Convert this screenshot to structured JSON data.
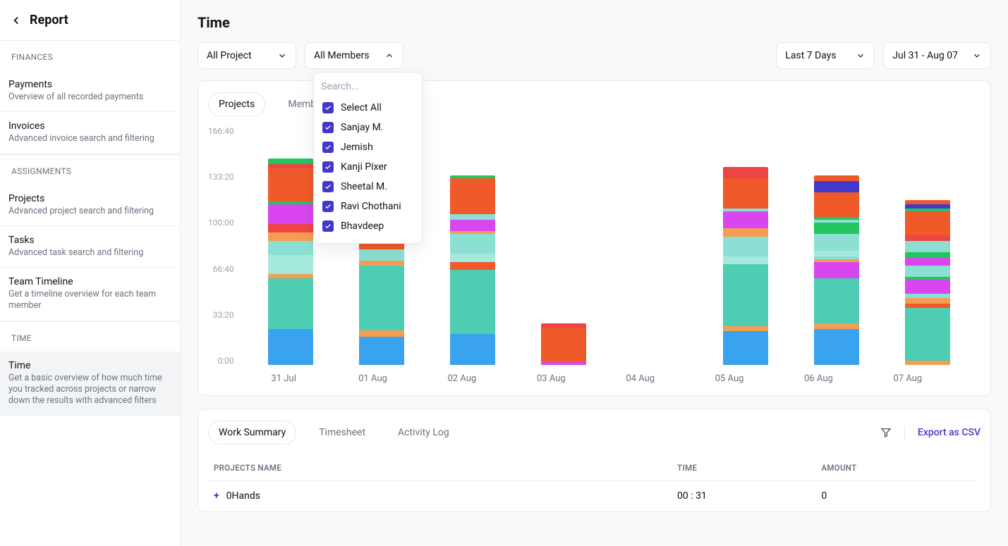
{
  "sidebar": {
    "back_label": "Report",
    "sections": [
      {
        "label": "FINANCES",
        "items": [
          {
            "title": "Payments",
            "sub": "Overview of all recorded payments"
          },
          {
            "title": "Invoices",
            "sub": "Advanced invoice search and filtering"
          }
        ]
      },
      {
        "label": "ASSIGNMENTS",
        "items": [
          {
            "title": "Projects",
            "sub": "Advanced project search and filtering"
          },
          {
            "title": "Tasks",
            "sub": "Advanced task search and filtering"
          },
          {
            "title": "Team Timeline",
            "sub": "Get a timeline overview for each team member"
          }
        ]
      },
      {
        "label": "TIME",
        "items": [
          {
            "title": "Time",
            "sub": "Get a basic overview of how much time you tracked across projects or narrow down the results with advanced filters",
            "active": true
          }
        ]
      }
    ]
  },
  "page_title": "Time",
  "filters": {
    "project": "All Project",
    "members": "All Members",
    "range_preset": "Last 7 Days",
    "range_dates": "Jul 31 - Aug 07"
  },
  "members_dropdown": {
    "search_placeholder": "Search...",
    "options": [
      "Select All",
      "Sanjay M.",
      "Jemish",
      "Kanji Pixer",
      "Sheetal M.",
      "Ravi Chothani",
      "Bhavdeep"
    ]
  },
  "chart_tabs": [
    "Projects",
    "Members"
  ],
  "chart_active_tab": "Projects",
  "chart_data": {
    "type": "bar",
    "stacked": true,
    "ylabel": "",
    "xlabel": "",
    "ylim": [
      0,
      166.67
    ],
    "y_ticks": [
      "166:40",
      "133:20",
      "100:00",
      "66:40",
      "33:20",
      "0:00"
    ],
    "categories": [
      "31 Jul",
      "01 Aug",
      "02 Aug",
      "03 Aug",
      "04 Aug",
      "05 Aug",
      "06 Aug",
      "07 Aug"
    ],
    "palette": {
      "blue": "#3aa3ef",
      "teal": "#4ecdb3",
      "tealLight": "#8be0d3",
      "orange": "#f59e53",
      "orangeRed": "#f05a2a",
      "red": "#ef4444",
      "magenta": "#d946ef",
      "green": "#22c55e",
      "indigo": "#4338ca",
      "cyan": "#a5e8dc"
    },
    "series_comment": "values are approximate minutes (y axis in hh:mm, full scale ~166:40 = 10000 min)",
    "stacks": [
      {
        "cat": "31 Jul",
        "total": 148,
        "segments": [
          {
            "c": "blue",
            "v": 26
          },
          {
            "c": "teal",
            "v": 36
          },
          {
            "c": "orange",
            "v": 3
          },
          {
            "c": "cyan",
            "v": 14
          },
          {
            "c": "tealLight",
            "v": 10
          },
          {
            "c": "orange",
            "v": 6
          },
          {
            "c": "red",
            "v": 6
          },
          {
            "c": "magenta",
            "v": 14
          },
          {
            "c": "green",
            "v": 2
          },
          {
            "c": "orangeRed",
            "v": 24
          },
          {
            "c": "red",
            "v": 3
          },
          {
            "c": "green",
            "v": 4
          }
        ]
      },
      {
        "cat": "01 Aug",
        "total": 102,
        "segments": [
          {
            "c": "blue",
            "v": 20
          },
          {
            "c": "orange",
            "v": 5
          },
          {
            "c": "teal",
            "v": 46
          },
          {
            "c": "orange",
            "v": 4
          },
          {
            "c": "tealLight",
            "v": 8
          },
          {
            "c": "orangeRed",
            "v": 4
          },
          {
            "c": "red",
            "v": 4
          },
          {
            "c": "orangeRed",
            "v": 11
          }
        ]
      },
      {
        "cat": "02 Aug",
        "total": 136,
        "segments": [
          {
            "c": "blue",
            "v": 22
          },
          {
            "c": "teal",
            "v": 46
          },
          {
            "c": "orangeRed",
            "v": 6
          },
          {
            "c": "cyan",
            "v": 6
          },
          {
            "c": "tealLight",
            "v": 14
          },
          {
            "c": "orange",
            "v": 2
          },
          {
            "c": "magenta",
            "v": 8
          },
          {
            "c": "tealLight",
            "v": 4
          },
          {
            "c": "orangeRed",
            "v": 26
          },
          {
            "c": "green",
            "v": 2
          }
        ]
      },
      {
        "cat": "03 Aug",
        "total": 30,
        "segments": [
          {
            "c": "magenta",
            "v": 2
          },
          {
            "c": "orangeRed",
            "v": 25
          },
          {
            "c": "red",
            "v": 3
          }
        ]
      },
      {
        "cat": "04 Aug",
        "total": 0,
        "segments": []
      },
      {
        "cat": "05 Aug",
        "total": 142,
        "segments": [
          {
            "c": "blue",
            "v": 24
          },
          {
            "c": "orange",
            "v": 4
          },
          {
            "c": "teal",
            "v": 44
          },
          {
            "c": "cyan",
            "v": 6
          },
          {
            "c": "tealLight",
            "v": 14
          },
          {
            "c": "orange",
            "v": 6
          },
          {
            "c": "magenta",
            "v": 12
          },
          {
            "c": "tealLight",
            "v": 2
          },
          {
            "c": "orangeRed",
            "v": 22
          },
          {
            "c": "red",
            "v": 8
          }
        ]
      },
      {
        "cat": "06 Aug",
        "total": 136,
        "segments": [
          {
            "c": "blue",
            "v": 26
          },
          {
            "c": "orange",
            "v": 4
          },
          {
            "c": "teal",
            "v": 32
          },
          {
            "c": "magenta",
            "v": 12
          },
          {
            "c": "orange",
            "v": 2
          },
          {
            "c": "tealLight",
            "v": 2
          },
          {
            "c": "cyan",
            "v": 4
          },
          {
            "c": "tealLight",
            "v": 12
          },
          {
            "c": "green",
            "v": 8
          },
          {
            "c": "tealLight",
            "v": 2
          },
          {
            "c": "green",
            "v": 2
          },
          {
            "c": "orangeRed",
            "v": 18
          },
          {
            "c": "indigo",
            "v": 8
          },
          {
            "c": "orangeRed",
            "v": 4
          }
        ]
      },
      {
        "cat": "07 Aug",
        "total": 118,
        "segments": [
          {
            "c": "orange",
            "v": 3
          },
          {
            "c": "teal",
            "v": 38
          },
          {
            "c": "orangeRed",
            "v": 3
          },
          {
            "c": "orange",
            "v": 4
          },
          {
            "c": "tealLight",
            "v": 3
          },
          {
            "c": "magenta",
            "v": 10
          },
          {
            "c": "green",
            "v": 2
          },
          {
            "c": "tealLight",
            "v": 8
          },
          {
            "c": "magenta",
            "v": 6
          },
          {
            "c": "green",
            "v": 4
          },
          {
            "c": "tealLight",
            "v": 8
          },
          {
            "c": "red",
            "v": 4
          },
          {
            "c": "orangeRed",
            "v": 17
          },
          {
            "c": "green",
            "v": 2
          },
          {
            "c": "indigo",
            "v": 3
          },
          {
            "c": "orangeRed",
            "v": 3
          }
        ]
      }
    ]
  },
  "summary_tabs": [
    "Work Summary",
    "Timesheet",
    "Activity Log"
  ],
  "summary_active_tab": "Work Summary",
  "export_label": "Export as CSV",
  "table": {
    "columns": [
      "PROJECTS NAME",
      "TIME",
      "AMOUNT"
    ],
    "rows": [
      {
        "name": "0Hands",
        "time": "00 : 31",
        "amount": "0"
      }
    ]
  }
}
